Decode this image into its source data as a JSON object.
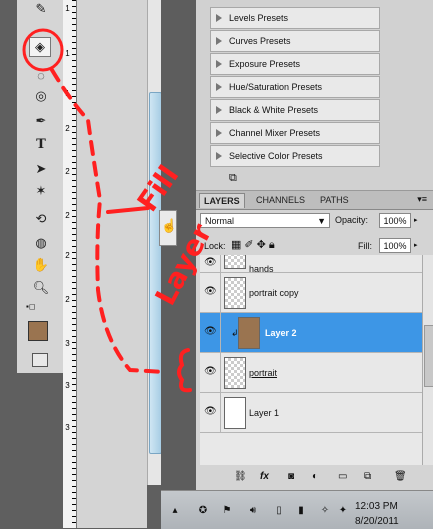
{
  "toolbox": {
    "tools": [
      "wand-icon",
      "paint-bucket-icon",
      "eraser-icon",
      "blur-icon",
      "pen-icon",
      "type-icon",
      "path-select-icon",
      "shape-icon",
      "3d-rotate-icon",
      "3d-orbit-icon",
      "hand-icon",
      "zoom-icon"
    ],
    "foreground_color": "#9a7450",
    "background_color": "#eeeeee"
  },
  "ruler": {
    "numbers": [
      "1",
      "1",
      "1",
      "2",
      "2",
      "2",
      "2",
      "2",
      "3",
      "3",
      "3"
    ]
  },
  "presets": {
    "items": [
      "Levels Presets",
      "Curves Presets",
      "Exposure Presets",
      "Hue/Saturation Presets",
      "Black & White Presets",
      "Channel Mixer Presets",
      "Selective Color Presets"
    ]
  },
  "layers_panel": {
    "tabs": [
      "LAYERS",
      "CHANNELS",
      "PATHS"
    ],
    "panel_menu": "▾≡",
    "blend_mode": "Normal",
    "opacity_label": "Opacity:",
    "opacity_value": "100%",
    "lock_label": "Lock:",
    "fill_label": "Fill:",
    "fill_value": "100%",
    "layers": [
      {
        "name": "hands",
        "selected": false
      },
      {
        "name": "portrait copy",
        "selected": false
      },
      {
        "name": "Layer 2",
        "selected": true
      },
      {
        "name": "portrait",
        "selected": false
      },
      {
        "name": "Layer 1",
        "selected": false
      }
    ],
    "selected_color": "#3d96e6"
  },
  "taskbar": {
    "time": "12:03 PM",
    "date": "8/20/2011"
  },
  "annotation": {
    "text_fill": "Fill",
    "text_layer": "Layer",
    "color": "#ff2020"
  }
}
